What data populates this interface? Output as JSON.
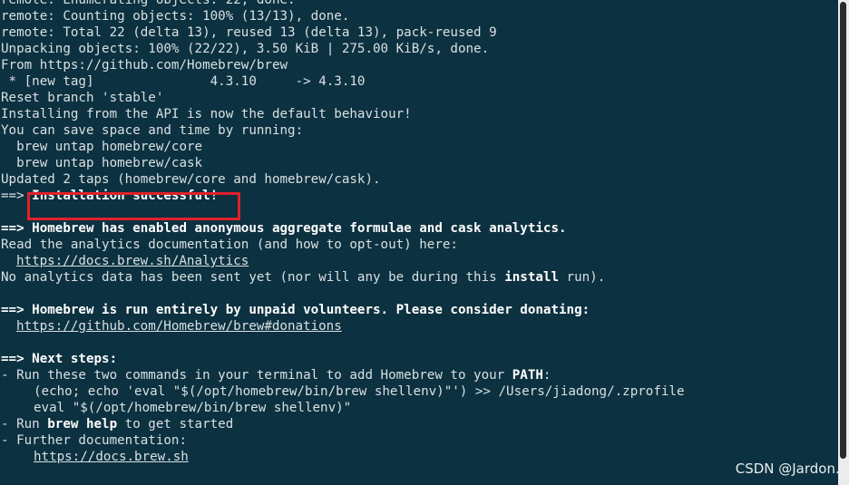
{
  "terminal": {
    "lines": [
      "remote: Enumerating objects: 22, done.",
      "remote: Counting objects: 100% (13/13), done.",
      "remote: Total 22 (delta 13), reused 13 (delta 13), pack-reused 9",
      "Unpacking objects: 100% (22/22), 3.50 KiB | 275.00 KiB/s, done.",
      "From https://github.com/Homebrew/brew",
      " * [new tag]               4.3.10     -> 4.3.10",
      "Reset branch 'stable'",
      "Installing from the API is now the default behaviour!",
      "You can save space and time by running:",
      "  brew untap homebrew/core",
      "  brew untap homebrew/cask",
      "Updated 2 taps (homebrew/core and homebrew/cask)."
    ],
    "install_prefix": "==> ",
    "install_success": "Installation successful!",
    "analytics_prefix": "==> ",
    "analytics_heading": "Homebrew has enabled anonymous aggregate formulae and cask analytics.",
    "analytics_read": "Read the analytics documentation (and how to opt-out) here:",
    "analytics_url": "https://docs.brew.sh/Analytics",
    "analytics_none_a": "No analytics data has been sent yet (nor will any be during this ",
    "analytics_none_b": "install",
    "analytics_none_c": " run).",
    "donate_prefix": "==> ",
    "donate_heading": "Homebrew is run entirely by unpaid volunteers. Please consider donating:",
    "donate_url": "https://github.com/Homebrew/brew#donations",
    "next_prefix": "==> ",
    "next_heading": "Next steps:",
    "next_run_a": "- Run these two commands in your terminal to add Homebrew to your ",
    "next_run_b": "PATH",
    "next_run_c": ":",
    "cmd1": "(echo; echo 'eval \"$(/opt/homebrew/bin/brew shellenv)\"') >> /Users/jiadong/.zprofile",
    "cmd2": "eval \"$(/opt/homebrew/bin/brew shellenv)\"",
    "help_a": "- Run ",
    "help_b": "brew help",
    "help_c": " to get started",
    "docs_label": "- Further documentation:",
    "docs_url": "https://docs.brew.sh"
  },
  "watermark": "CSDN @Jardon.▯",
  "colors": {
    "background": "#0c3140",
    "text": "#d8e0e2",
    "highlight_border": "#e0212a"
  }
}
